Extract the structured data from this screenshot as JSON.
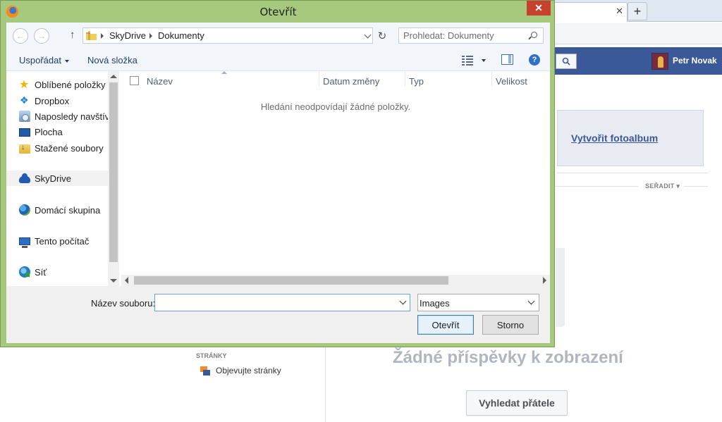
{
  "dialog": {
    "title": "Otevřít",
    "close_glyph": "✕",
    "nav": {
      "back_glyph": "←",
      "forward_glyph": "→",
      "up_glyph": "↑",
      "refresh_glyph": "↻",
      "breadcrumb": [
        "SkyDrive",
        "Dokumenty"
      ],
      "search_placeholder": "Prohledat: Dokumenty"
    },
    "toolbar": {
      "organize": "Uspořádat",
      "new_folder": "Nová složka",
      "help_glyph": "?"
    },
    "sidebar": {
      "favorites": [
        {
          "label": "Oblíbené položky",
          "icon": "star-icon"
        },
        {
          "label": "Dropbox",
          "icon": "dropbox-icon"
        },
        {
          "label": "Naposledy navštív",
          "icon": "recent-places-icon"
        },
        {
          "label": "Plocha",
          "icon": "desktop-icon"
        },
        {
          "label": "Stažené soubory",
          "icon": "downloads-icon"
        }
      ],
      "skydrive": "SkyDrive",
      "homegroup": "Domácí skupina",
      "this_pc": "Tento počítač",
      "network": "Síť"
    },
    "columns": [
      "Název",
      "Datum změny",
      "Typ",
      "Velikost"
    ],
    "empty_message": "Hledání neodpovídají žádné položky.",
    "filename_label": "Název souboru:",
    "filename_value": "",
    "filetype_value": "Images",
    "open_button": "Otevřít",
    "cancel_button": "Storno"
  },
  "background": {
    "tab_close_glyph": "✕",
    "new_tab_glyph": "+",
    "user_name": "Petr Novak",
    "create_album": "Vytvořit fotoalbum",
    "sort_label": "SEŘADIT",
    "pages_heading": "STRÁNKY",
    "discover_pages": "Objevujte stránky",
    "no_posts": "Žádné příspěvky k zobrazení",
    "find_friends": "Vyhledat přátele"
  },
  "colors": {
    "dialog_frame": "#a7c97e",
    "close_button": "#c7412f",
    "facebook_blue": "#3b5998"
  }
}
